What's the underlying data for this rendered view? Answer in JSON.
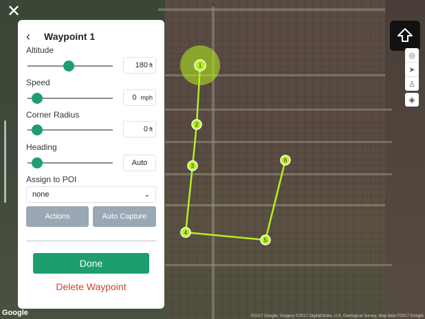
{
  "panel": {
    "title": "Waypoint 1",
    "altitude": {
      "label": "Altitude",
      "value": "180",
      "unit": "ft",
      "level": 0.42
    },
    "speed": {
      "label": "Speed",
      "value": "0",
      "unit": "mph",
      "level": 0.05
    },
    "corner_radius": {
      "label": "Corner Radius",
      "value": "0",
      "unit": "ft",
      "level": 0.05
    },
    "heading": {
      "label": "Heading",
      "value": "Auto",
      "level": 0.05
    },
    "poi": {
      "label": "Assign to POI",
      "selected": "none"
    },
    "actions_label": "Actions",
    "auto_capture_label": "Auto Capture",
    "done_label": "Done",
    "delete_label": "Delete Waypoint"
  },
  "map": {
    "logo": "Google",
    "attribution": "©2017 Google, Imagery ©2017 DigitalGlobe, U.S. Geological Survey, Map data ©2017 Google",
    "waypoints": [
      "1",
      "2",
      "3",
      "4",
      "5",
      "6"
    ],
    "route_color": "#b6f01e"
  },
  "icons": {
    "close": "close-icon",
    "back": "chevron-left-icon",
    "dropdown": "chevron-down-icon",
    "home": "home-arrow-icon",
    "layers": "layers-icon"
  },
  "colors": {
    "accent": "#1e9e6f",
    "danger": "#d3402a",
    "secondary_button": "#9aa7b4"
  }
}
